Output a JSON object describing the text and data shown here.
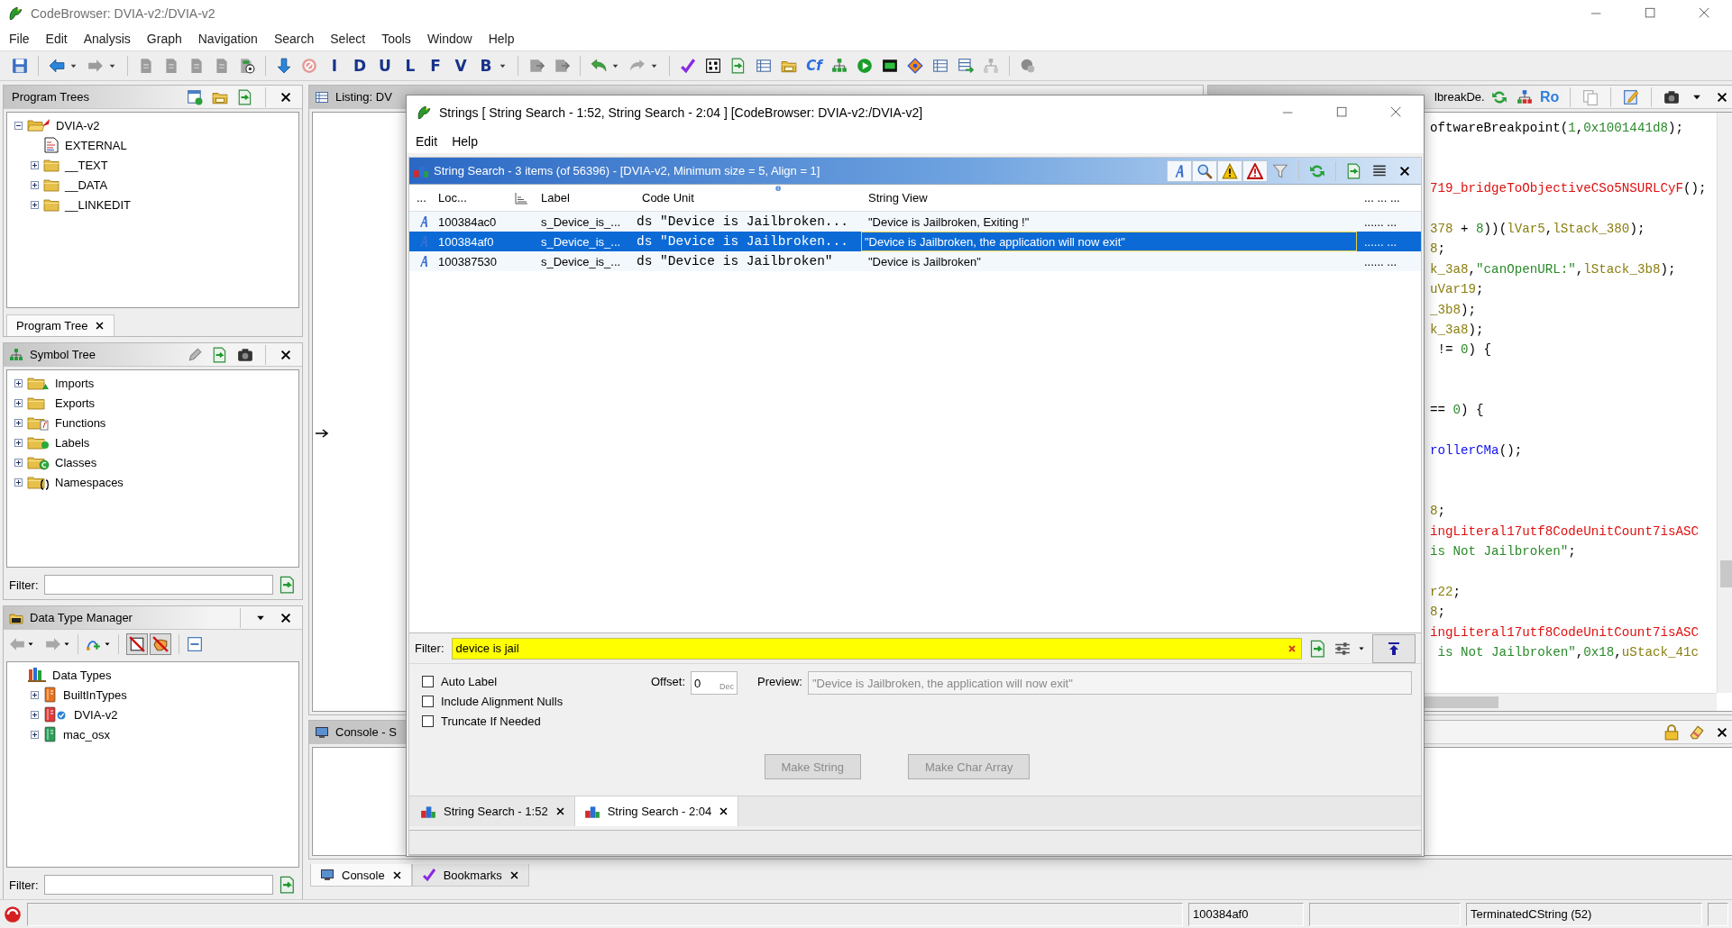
{
  "window": {
    "title": "CodeBrowser: DVIA-v2:/DVIA-v2"
  },
  "menu": [
    "File",
    "Edit",
    "Analysis",
    "Graph",
    "Navigation",
    "Search",
    "Select",
    "Tools",
    "Window",
    "Help"
  ],
  "toolbar": [
    {
      "kind": "save"
    },
    {
      "kind": "separator"
    },
    {
      "kind": "back",
      "dropdown": true
    },
    {
      "kind": "forward",
      "dropdown": true
    },
    {
      "kind": "separator"
    },
    {
      "kind": "page"
    },
    {
      "kind": "page"
    },
    {
      "kind": "page"
    },
    {
      "kind": "page"
    },
    {
      "kind": "page-gear"
    },
    {
      "kind": "separator"
    },
    {
      "kind": "down"
    },
    {
      "kind": "stop"
    },
    {
      "kind": "letter",
      "label": "I"
    },
    {
      "kind": "letter",
      "label": "D"
    },
    {
      "kind": "letter",
      "label": "U"
    },
    {
      "kind": "letter",
      "label": "L"
    },
    {
      "kind": "letter",
      "label": "F"
    },
    {
      "kind": "letter",
      "label": "V"
    },
    {
      "kind": "letter",
      "label": "B",
      "dropdown": true
    },
    {
      "kind": "separator"
    },
    {
      "kind": "puzzle"
    },
    {
      "kind": "puzzle"
    },
    {
      "kind": "separator"
    },
    {
      "kind": "undo",
      "dropdown": true
    },
    {
      "kind": "redo",
      "dropdown": true
    },
    {
      "kind": "separator"
    },
    {
      "kind": "check"
    },
    {
      "kind": "binary"
    },
    {
      "kind": "sheet"
    },
    {
      "kind": "table"
    },
    {
      "kind": "folder"
    },
    {
      "kind": "letter",
      "label": "Cf"
    },
    {
      "kind": "hierarchy"
    },
    {
      "kind": "play"
    },
    {
      "kind": "chip"
    },
    {
      "kind": "diamond"
    },
    {
      "kind": "table"
    },
    {
      "kind": "table-arrow"
    },
    {
      "kind": "tree"
    },
    {
      "kind": "separator"
    },
    {
      "kind": "cluster"
    }
  ],
  "program_trees": {
    "title": "Program Trees",
    "tree": [
      {
        "label": "DVIA-v2",
        "kind": "program",
        "expanded": true,
        "children": [
          {
            "label": "EXTERNAL",
            "kind": "file"
          },
          {
            "label": "__TEXT",
            "kind": "folder",
            "expanded": false
          },
          {
            "label": "__DATA",
            "kind": "folder",
            "expanded": false
          },
          {
            "label": "__LINKEDIT",
            "kind": "folder",
            "expanded": false
          }
        ]
      }
    ],
    "tabs": [
      {
        "label": "Program Tree",
        "selected": true
      }
    ]
  },
  "symbol_tree": {
    "title": "Symbol Tree",
    "items": [
      {
        "label": "Imports",
        "kind": "imports",
        "expanded": false
      },
      {
        "label": "Exports",
        "kind": "exports",
        "expanded": false
      },
      {
        "label": "Functions",
        "kind": "functions",
        "expanded": false
      },
      {
        "label": "Labels",
        "kind": "labels",
        "expanded": false
      },
      {
        "label": "Classes",
        "kind": "classes",
        "expanded": false
      },
      {
        "label": "Namespaces",
        "kind": "namespaces",
        "expanded": false
      }
    ],
    "filter_label": "Filter:"
  },
  "data_type_manager": {
    "title": "Data Type Manager",
    "tree": [
      {
        "label": "Data Types",
        "kind": "root",
        "children": [
          {
            "label": "BuiltInTypes",
            "kind": "archive",
            "color": "#e8731a",
            "expanded": false
          },
          {
            "label": "DVIA-v2",
            "kind": "program-archive",
            "color": "#e03a3a",
            "expanded": false
          },
          {
            "label": "mac_osx",
            "kind": "archive",
            "color": "#2aa05a",
            "expanded": false
          }
        ]
      }
    ],
    "filter_label": "Filter:"
  },
  "listing": {
    "title": "Listing:  DV"
  },
  "decompiler": {
    "title": "lbreakDe.",
    "button_label": "Ro",
    "lines": [
      {
        "kind": "code",
        "segments": [
          {
            "text": "oftwareBreakpoint(",
            "kind": "plain"
          },
          {
            "text": "1",
            "kind": "num"
          },
          {
            "text": ",",
            "kind": "plain"
          },
          {
            "text": "0x1001441d8",
            "kind": "num"
          },
          {
            "text": ");",
            "kind": "plain"
          }
        ]
      },
      {
        "kind": "blank"
      },
      {
        "kind": "blank"
      },
      {
        "kind": "code",
        "segments": [
          {
            "text": "719_bridgeToObjectiveCSo5NSURLCyF",
            "kind": "fn"
          },
          {
            "text": "();",
            "kind": "plain"
          }
        ]
      },
      {
        "kind": "blank"
      },
      {
        "kind": "code",
        "segments": [
          {
            "text": "378",
            "kind": "var"
          },
          {
            "text": " + ",
            "kind": "plain"
          },
          {
            "text": "8",
            "kind": "num"
          },
          {
            "text": "))(",
            "kind": "plain"
          },
          {
            "text": "lVar5",
            "kind": "var"
          },
          {
            "text": ",",
            "kind": "plain"
          },
          {
            "text": "lStack_380",
            "kind": "var"
          },
          {
            "text": ");",
            "kind": "plain"
          }
        ]
      },
      {
        "kind": "code",
        "segments": [
          {
            "text": "8",
            "kind": "var"
          },
          {
            "text": ";",
            "kind": "plain"
          }
        ]
      },
      {
        "kind": "code",
        "segments": [
          {
            "text": "k_3a8",
            "kind": "var"
          },
          {
            "text": ",",
            "kind": "plain"
          },
          {
            "text": "\"canOpenURL:\"",
            "kind": "str"
          },
          {
            "text": ",",
            "kind": "plain"
          },
          {
            "text": "lStack_3b8",
            "kind": "var"
          },
          {
            "text": ");",
            "kind": "plain"
          }
        ]
      },
      {
        "kind": "code",
        "segments": [
          {
            "text": "uVar19",
            "kind": "var"
          },
          {
            "text": ";",
            "kind": "plain"
          }
        ]
      },
      {
        "kind": "code",
        "segments": [
          {
            "text": "_3b8",
            "kind": "var"
          },
          {
            "text": ");",
            "kind": "plain"
          }
        ]
      },
      {
        "kind": "code",
        "segments": [
          {
            "text": "k_3a8",
            "kind": "var"
          },
          {
            "text": ");",
            "kind": "plain"
          }
        ]
      },
      {
        "kind": "code",
        "segments": [
          {
            "text": " != ",
            "kind": "plain"
          },
          {
            "text": "0",
            "kind": "num"
          },
          {
            "text": ") {",
            "kind": "plain"
          }
        ]
      },
      {
        "kind": "blank"
      },
      {
        "kind": "blank"
      },
      {
        "kind": "code",
        "segments": [
          {
            "text": "== ",
            "kind": "plain"
          },
          {
            "text": "0",
            "kind": "num"
          },
          {
            "text": ") {",
            "kind": "plain"
          }
        ]
      },
      {
        "kind": "blank"
      },
      {
        "kind": "code",
        "segments": [
          {
            "text": "rollerCMa",
            "kind": "call"
          },
          {
            "text": "();",
            "kind": "plain"
          }
        ]
      },
      {
        "kind": "blank"
      },
      {
        "kind": "blank"
      },
      {
        "kind": "code",
        "segments": [
          {
            "text": "8",
            "kind": "var"
          },
          {
            "text": ";",
            "kind": "plain"
          }
        ]
      },
      {
        "kind": "code",
        "segments": [
          {
            "text": "ingLiteral17utf8CodeUnitCount7isASC",
            "kind": "fn"
          }
        ]
      },
      {
        "kind": "code",
        "segments": [
          {
            "text": "is Not Jailbroken\"",
            "kind": "str"
          },
          {
            "text": ";",
            "kind": "plain"
          }
        ]
      },
      {
        "kind": "blank"
      },
      {
        "kind": "code",
        "segments": [
          {
            "text": "r22",
            "kind": "var"
          },
          {
            "text": ";",
            "kind": "plain"
          }
        ]
      },
      {
        "kind": "code",
        "segments": [
          {
            "text": "8",
            "kind": "var"
          },
          {
            "text": ";",
            "kind": "plain"
          }
        ]
      },
      {
        "kind": "code",
        "segments": [
          {
            "text": "ingLiteral17utf8CodeUnitCount7isASC",
            "kind": "fn"
          }
        ]
      },
      {
        "kind": "code",
        "segments": [
          {
            "text": " is Not Jailbroken\"",
            "kind": "str"
          },
          {
            "text": ",",
            "kind": "plain"
          },
          {
            "text": "0x18",
            "kind": "num"
          },
          {
            "text": ",",
            "kind": "plain"
          },
          {
            "text": "uStack_41c",
            "kind": "var"
          }
        ]
      }
    ]
  },
  "console": {
    "title": "Console - S"
  },
  "bottom_tabs": [
    {
      "label": "Console",
      "selected": true
    },
    {
      "label": "Bookmarks",
      "selected": false
    }
  ],
  "strings_dialog": {
    "title": "Strings [ String Search - 1:52, String Search - 2:04 ] [CodeBrowser: DVIA-v2:/DVIA-v2]",
    "menu": [
      "Edit",
      "Help"
    ],
    "header": "String Search - 3 items (of 56396) - [DVIA-v2, Minimum size = 5, Align = 1]",
    "columns": [
      "...",
      "Loc...",
      "Label",
      "Code Unit",
      "String View",
      "... ... ..."
    ],
    "rows": [
      {
        "location": "100384ac0",
        "label": "s_Device_is_...",
        "code_unit": "ds \"Device is Jailbroken...",
        "string_view": "\"Device is Jailbroken, Exiting !\"",
        "column_7": "...... ...",
        "selected": false
      },
      {
        "location": "100384af0",
        "label": "s_Device_is_...",
        "code_unit": "ds \"Device is Jailbroken...",
        "string_view": "\"Device is Jailbroken, the application will now exit\"",
        "column_7": "...... ...",
        "selected": true
      },
      {
        "location": "100387530",
        "label": "s_Device_is_...",
        "code_unit": "ds \"Device is Jailbroken\"",
        "string_view": "\"Device is Jailbroken\"",
        "column_7": "...... ...",
        "selected": false
      }
    ],
    "filter": {
      "label": "Filter:",
      "value": "device is jail"
    },
    "options": [
      {
        "label": "Auto Label",
        "checked": false
      },
      {
        "label": "Include Alignment Nulls",
        "checked": false
      },
      {
        "label": "Truncate If Needed",
        "checked": false
      }
    ],
    "offset": {
      "label": "Offset:",
      "value": "0",
      "unit": "Dec"
    },
    "preview": {
      "label": "Preview:",
      "value": "\"Device is Jailbroken, the application will now exit\""
    },
    "buttons": [
      {
        "label": "Make String",
        "disabled": true
      },
      {
        "label": "Make Char Array",
        "disabled": true
      }
    ],
    "tabs": [
      {
        "label": "String Search - 1:52",
        "selected": false
      },
      {
        "label": "String Search - 2:04",
        "selected": true
      }
    ]
  },
  "status_bar": {
    "address": "100384af0",
    "data_type": "TerminatedCString  (52)"
  }
}
